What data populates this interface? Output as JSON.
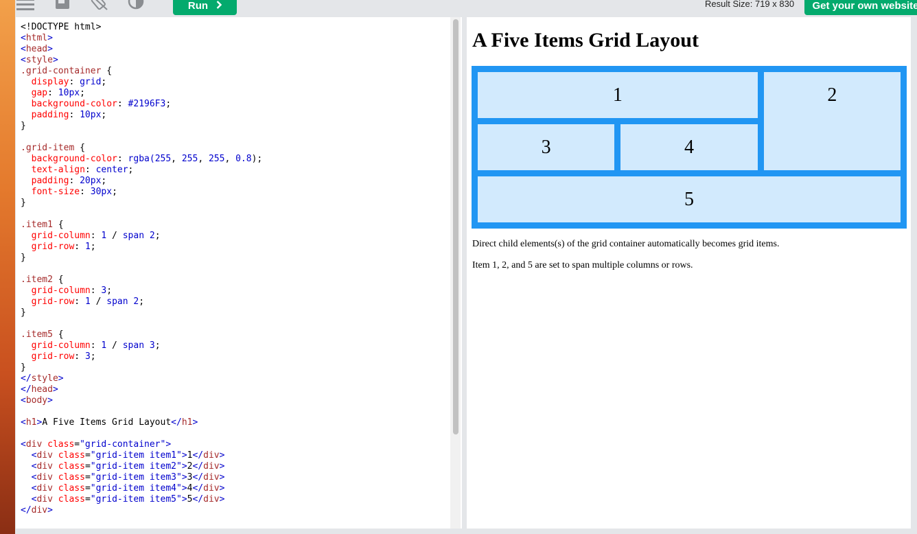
{
  "toolbar": {
    "run_label": "Run",
    "run_icon": "chevron-right-icon",
    "result_size": "Result Size: 719 x 830",
    "get_website_label": "Get your own website",
    "accent_color": "#04aa6d"
  },
  "editor": {
    "lines": [
      [
        {
          "t": "<!DOCTYPE html>",
          "c": ""
        }
      ],
      [
        {
          "t": "<",
          "c": "t-tag"
        },
        {
          "t": "html",
          "c": "t-el"
        },
        {
          "t": ">",
          "c": "t-tag"
        }
      ],
      [
        {
          "t": "<",
          "c": "t-tag"
        },
        {
          "t": "head",
          "c": "t-el"
        },
        {
          "t": ">",
          "c": "t-tag"
        }
      ],
      [
        {
          "t": "<",
          "c": "t-tag"
        },
        {
          "t": "style",
          "c": "t-el"
        },
        {
          "t": ">",
          "c": "t-tag"
        }
      ],
      [
        {
          "t": ".grid-container",
          "c": "t-el"
        },
        {
          "t": " {",
          "c": ""
        }
      ],
      [
        {
          "t": "  display",
          "c": "t-prop"
        },
        {
          "t": ": ",
          "c": ""
        },
        {
          "t": "grid",
          "c": "t-val"
        },
        {
          "t": ";",
          "c": ""
        }
      ],
      [
        {
          "t": "  gap",
          "c": "t-prop"
        },
        {
          "t": ": ",
          "c": ""
        },
        {
          "t": "10px",
          "c": "t-val"
        },
        {
          "t": ";",
          "c": ""
        }
      ],
      [
        {
          "t": "  background-color",
          "c": "t-prop"
        },
        {
          "t": ": ",
          "c": ""
        },
        {
          "t": "#2196F3",
          "c": "t-val"
        },
        {
          "t": ";",
          "c": ""
        }
      ],
      [
        {
          "t": "  padding",
          "c": "t-prop"
        },
        {
          "t": ": ",
          "c": ""
        },
        {
          "t": "10px",
          "c": "t-val"
        },
        {
          "t": ";",
          "c": ""
        }
      ],
      [
        {
          "t": "}",
          "c": ""
        }
      ],
      [
        {
          "t": "",
          "c": ""
        }
      ],
      [
        {
          "t": ".grid-item",
          "c": "t-el"
        },
        {
          "t": " {",
          "c": ""
        }
      ],
      [
        {
          "t": "  background-color",
          "c": "t-prop"
        },
        {
          "t": ": ",
          "c": ""
        },
        {
          "t": "rgba(",
          "c": "t-val"
        },
        {
          "t": "255",
          "c": "t-val"
        },
        {
          "t": ", ",
          "c": ""
        },
        {
          "t": "255",
          "c": "t-val"
        },
        {
          "t": ", ",
          "c": ""
        },
        {
          "t": "255",
          "c": "t-val"
        },
        {
          "t": ", ",
          "c": ""
        },
        {
          "t": "0.8",
          "c": "t-val"
        },
        {
          "t": ");",
          "c": ""
        }
      ],
      [
        {
          "t": "  text-align",
          "c": "t-prop"
        },
        {
          "t": ": ",
          "c": ""
        },
        {
          "t": "center",
          "c": "t-val"
        },
        {
          "t": ";",
          "c": ""
        }
      ],
      [
        {
          "t": "  padding",
          "c": "t-prop"
        },
        {
          "t": ": ",
          "c": ""
        },
        {
          "t": "20px",
          "c": "t-val"
        },
        {
          "t": ";",
          "c": ""
        }
      ],
      [
        {
          "t": "  font-size",
          "c": "t-prop"
        },
        {
          "t": ": ",
          "c": ""
        },
        {
          "t": "30px",
          "c": "t-val"
        },
        {
          "t": ";",
          "c": ""
        }
      ],
      [
        {
          "t": "}",
          "c": ""
        }
      ],
      [
        {
          "t": "",
          "c": ""
        }
      ],
      [
        {
          "t": ".item1",
          "c": "t-el"
        },
        {
          "t": " {",
          "c": ""
        }
      ],
      [
        {
          "t": "  grid-column",
          "c": "t-prop"
        },
        {
          "t": ": ",
          "c": ""
        },
        {
          "t": "1",
          "c": "t-val"
        },
        {
          "t": " / ",
          "c": ""
        },
        {
          "t": "span 2",
          "c": "t-val"
        },
        {
          "t": ";",
          "c": ""
        }
      ],
      [
        {
          "t": "  grid-row",
          "c": "t-prop"
        },
        {
          "t": ": ",
          "c": ""
        },
        {
          "t": "1",
          "c": "t-val"
        },
        {
          "t": ";",
          "c": ""
        }
      ],
      [
        {
          "t": "}",
          "c": ""
        }
      ],
      [
        {
          "t": "",
          "c": ""
        }
      ],
      [
        {
          "t": ".item2",
          "c": "t-el"
        },
        {
          "t": " {",
          "c": ""
        }
      ],
      [
        {
          "t": "  grid-column",
          "c": "t-prop"
        },
        {
          "t": ": ",
          "c": ""
        },
        {
          "t": "3",
          "c": "t-val"
        },
        {
          "t": ";",
          "c": ""
        }
      ],
      [
        {
          "t": "  grid-row",
          "c": "t-prop"
        },
        {
          "t": ": ",
          "c": ""
        },
        {
          "t": "1",
          "c": "t-val"
        },
        {
          "t": " / ",
          "c": ""
        },
        {
          "t": "span 2",
          "c": "t-val"
        },
        {
          "t": ";",
          "c": ""
        }
      ],
      [
        {
          "t": "}",
          "c": ""
        }
      ],
      [
        {
          "t": "",
          "c": ""
        }
      ],
      [
        {
          "t": ".item5",
          "c": "t-el"
        },
        {
          "t": " {",
          "c": ""
        }
      ],
      [
        {
          "t": "  grid-column",
          "c": "t-prop"
        },
        {
          "t": ": ",
          "c": ""
        },
        {
          "t": "1",
          "c": "t-val"
        },
        {
          "t": " / ",
          "c": ""
        },
        {
          "t": "span 3",
          "c": "t-val"
        },
        {
          "t": ";",
          "c": ""
        }
      ],
      [
        {
          "t": "  grid-row",
          "c": "t-prop"
        },
        {
          "t": ": ",
          "c": ""
        },
        {
          "t": "3",
          "c": "t-val"
        },
        {
          "t": ";",
          "c": ""
        }
      ],
      [
        {
          "t": "}",
          "c": ""
        }
      ],
      [
        {
          "t": "</",
          "c": "t-tag"
        },
        {
          "t": "style",
          "c": "t-el"
        },
        {
          "t": ">",
          "c": "t-tag"
        }
      ],
      [
        {
          "t": "</",
          "c": "t-tag"
        },
        {
          "t": "head",
          "c": "t-el"
        },
        {
          "t": ">",
          "c": "t-tag"
        }
      ],
      [
        {
          "t": "<",
          "c": "t-tag"
        },
        {
          "t": "body",
          "c": "t-el"
        },
        {
          "t": ">",
          "c": "t-tag"
        }
      ],
      [
        {
          "t": "",
          "c": ""
        }
      ],
      [
        {
          "t": "<",
          "c": "t-tag"
        },
        {
          "t": "h1",
          "c": "t-el"
        },
        {
          "t": ">",
          "c": "t-tag"
        },
        {
          "t": "A Five Items Grid Layout",
          "c": ""
        },
        {
          "t": "</",
          "c": "t-tag"
        },
        {
          "t": "h1",
          "c": "t-el"
        },
        {
          "t": ">",
          "c": "t-tag"
        }
      ],
      [
        {
          "t": "",
          "c": ""
        }
      ],
      [
        {
          "t": "<",
          "c": "t-tag"
        },
        {
          "t": "div ",
          "c": "t-el"
        },
        {
          "t": "class",
          "c": "t-attr"
        },
        {
          "t": "=",
          "c": ""
        },
        {
          "t": "\"grid-container\"",
          "c": "t-val"
        },
        {
          "t": ">",
          "c": "t-tag"
        }
      ],
      [
        {
          "t": "  <",
          "c": "t-tag"
        },
        {
          "t": "div ",
          "c": "t-el"
        },
        {
          "t": "class",
          "c": "t-attr"
        },
        {
          "t": "=",
          "c": ""
        },
        {
          "t": "\"grid-item item1\"",
          "c": "t-val"
        },
        {
          "t": ">",
          "c": "t-tag"
        },
        {
          "t": "1",
          "c": ""
        },
        {
          "t": "</",
          "c": "t-tag"
        },
        {
          "t": "div",
          "c": "t-el"
        },
        {
          "t": ">",
          "c": "t-tag"
        }
      ],
      [
        {
          "t": "  <",
          "c": "t-tag"
        },
        {
          "t": "div ",
          "c": "t-el"
        },
        {
          "t": "class",
          "c": "t-attr"
        },
        {
          "t": "=",
          "c": ""
        },
        {
          "t": "\"grid-item item2\"",
          "c": "t-val"
        },
        {
          "t": ">",
          "c": "t-tag"
        },
        {
          "t": "2",
          "c": ""
        },
        {
          "t": "</",
          "c": "t-tag"
        },
        {
          "t": "div",
          "c": "t-el"
        },
        {
          "t": ">",
          "c": "t-tag"
        }
      ],
      [
        {
          "t": "  <",
          "c": "t-tag"
        },
        {
          "t": "div ",
          "c": "t-el"
        },
        {
          "t": "class",
          "c": "t-attr"
        },
        {
          "t": "=",
          "c": ""
        },
        {
          "t": "\"grid-item item3\"",
          "c": "t-val"
        },
        {
          "t": ">",
          "c": "t-tag"
        },
        {
          "t": "3",
          "c": ""
        },
        {
          "t": "</",
          "c": "t-tag"
        },
        {
          "t": "div",
          "c": "t-el"
        },
        {
          "t": ">",
          "c": "t-tag"
        }
      ],
      [
        {
          "t": "  <",
          "c": "t-tag"
        },
        {
          "t": "div ",
          "c": "t-el"
        },
        {
          "t": "class",
          "c": "t-attr"
        },
        {
          "t": "=",
          "c": ""
        },
        {
          "t": "\"grid-item item4\"",
          "c": "t-val"
        },
        {
          "t": ">",
          "c": "t-tag"
        },
        {
          "t": "4",
          "c": ""
        },
        {
          "t": "</",
          "c": "t-tag"
        },
        {
          "t": "div",
          "c": "t-el"
        },
        {
          "t": ">",
          "c": "t-tag"
        }
      ],
      [
        {
          "t": "  <",
          "c": "t-tag"
        },
        {
          "t": "div ",
          "c": "t-el"
        },
        {
          "t": "class",
          "c": "t-attr"
        },
        {
          "t": "=",
          "c": ""
        },
        {
          "t": "\"grid-item item5\"",
          "c": "t-val"
        },
        {
          "t": ">",
          "c": "t-tag"
        },
        {
          "t": "5",
          "c": ""
        },
        {
          "t": "</",
          "c": "t-tag"
        },
        {
          "t": "div",
          "c": "t-el"
        },
        {
          "t": ">",
          "c": "t-tag"
        }
      ],
      [
        {
          "t": "</",
          "c": "t-tag"
        },
        {
          "t": "div",
          "c": "t-el"
        },
        {
          "t": ">",
          "c": "t-tag"
        }
      ]
    ]
  },
  "result": {
    "heading": "A Five Items Grid Layout",
    "grid_color": "#2196F3",
    "items": [
      "1",
      "2",
      "3",
      "4",
      "5"
    ],
    "paragraph_1": "Direct child elements(s) of the grid container automatically becomes grid items.",
    "paragraph_2": "Item 1, 2, and 5 are set to span multiple columns or rows."
  },
  "icons": [
    "menu-icon",
    "save-icon",
    "orientation-icon",
    "theme-toggle-icon"
  ]
}
